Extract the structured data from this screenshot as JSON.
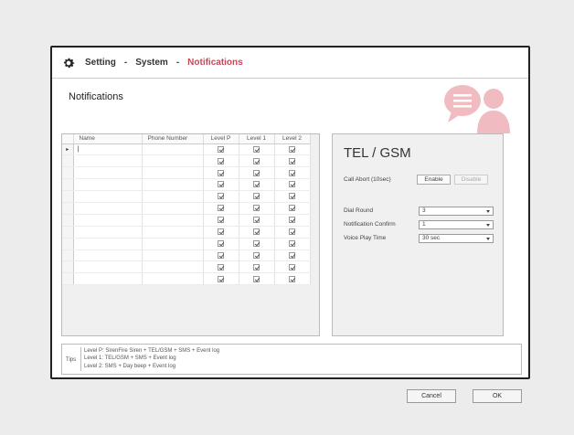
{
  "breadcrumb": {
    "setting": "Setting",
    "system": "System",
    "notifications": "Notifications",
    "separator": "-"
  },
  "section_title": "Notifications",
  "grid": {
    "columns": [
      "Name",
      "Phone Number",
      "Level P",
      "Level 1",
      "Level 2"
    ],
    "rows": [
      {
        "marker": "▸",
        "name": "|",
        "phone": "",
        "level_p": true,
        "level_1": true,
        "level_2": true
      },
      {
        "marker": "",
        "name": "",
        "phone": "",
        "level_p": true,
        "level_1": true,
        "level_2": true
      },
      {
        "marker": "",
        "name": "",
        "phone": "",
        "level_p": true,
        "level_1": true,
        "level_2": true
      },
      {
        "marker": "",
        "name": "",
        "phone": "",
        "level_p": true,
        "level_1": true,
        "level_2": true
      },
      {
        "marker": "",
        "name": "",
        "phone": "",
        "level_p": true,
        "level_1": true,
        "level_2": true
      },
      {
        "marker": "",
        "name": "",
        "phone": "",
        "level_p": true,
        "level_1": true,
        "level_2": true
      },
      {
        "marker": "",
        "name": "",
        "phone": "",
        "level_p": true,
        "level_1": true,
        "level_2": true
      },
      {
        "marker": "",
        "name": "",
        "phone": "",
        "level_p": true,
        "level_1": true,
        "level_2": true
      },
      {
        "marker": "",
        "name": "",
        "phone": "",
        "level_p": true,
        "level_1": true,
        "level_2": true
      },
      {
        "marker": "",
        "name": "",
        "phone": "",
        "level_p": true,
        "level_1": true,
        "level_2": true
      },
      {
        "marker": "",
        "name": "",
        "phone": "",
        "level_p": true,
        "level_1": true,
        "level_2": true
      },
      {
        "marker": "",
        "name": "",
        "phone": "",
        "level_p": true,
        "level_1": true,
        "level_2": true
      }
    ]
  },
  "tel_gsm": {
    "title": "TEL / GSM",
    "call_abort_label": "Call Abort (10sec)",
    "enable_label": "Enable",
    "disable_label": "Disable",
    "dial_round_label": "Dial Round",
    "dial_round_value": "3",
    "notification_confirm_label": "Notification Confirm",
    "notification_confirm_value": "1",
    "voice_play_time_label": "Voice Play Time",
    "voice_play_time_value": "30 sec"
  },
  "tips": {
    "label": "Tips",
    "lines": [
      "Level P: SirenFire Siren + TEL/GSM + SMS + Event log",
      "Level 1: TEL/GSM + SMS + Event log",
      "Level 2: SMS + Day beep + Event log"
    ]
  },
  "footer": {
    "cancel_label": "Cancel",
    "ok_label": "OK"
  },
  "colors": {
    "accent": "#c4485a",
    "icon_pink": "#f0bcc2"
  },
  "icons": {
    "settings": "gear-icon",
    "notifications_hero": "chat-user-icon",
    "row_selector": "row-pointer-icon",
    "dropdown": "chevron-down-icon"
  }
}
